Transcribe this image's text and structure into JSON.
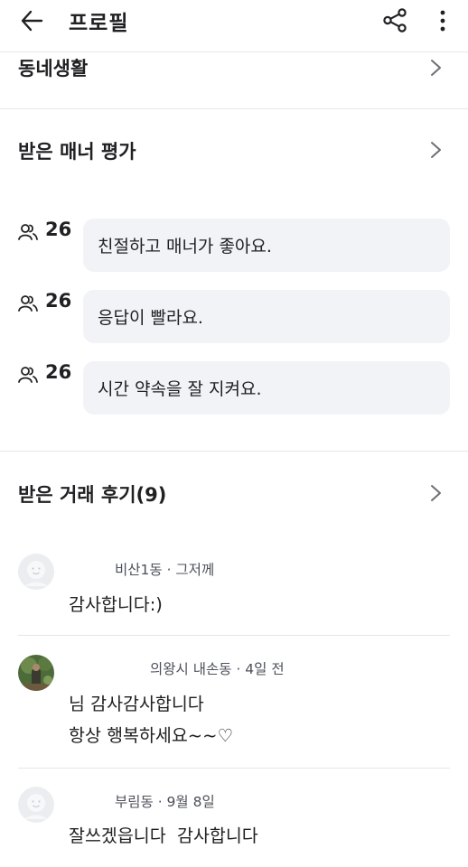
{
  "header": {
    "title": "프로필"
  },
  "sections": {
    "neighborhood": {
      "label": "동네생활"
    },
    "manner": {
      "label": "받은 매너 평가"
    },
    "reviews": {
      "label": "받은 거래 후기(9)"
    }
  },
  "manner_ratings": [
    {
      "count": "26",
      "text": "친절하고 매너가 좋아요."
    },
    {
      "count": "26",
      "text": "응답이 빨라요."
    },
    {
      "count": "26",
      "text": "시간 약속을 잘 지켜요."
    }
  ],
  "reviews": [
    {
      "meta": "비산1동 · 그저께",
      "lines": [
        "감사합니다:)"
      ]
    },
    {
      "meta": "의왕시 내손동 · 4일 전",
      "lines": [
        "님 감사감사합니다",
        "항상 행복하세요~~♡"
      ]
    },
    {
      "meta": "부림동 · 9월 8일",
      "lines": [
        "잘쓰겠읍니다  감사합니다"
      ]
    }
  ],
  "colors": {
    "text": "#212124",
    "meta": "#4d5159",
    "bubble": "#f2f3f6",
    "divider": "#e6e6e8"
  }
}
